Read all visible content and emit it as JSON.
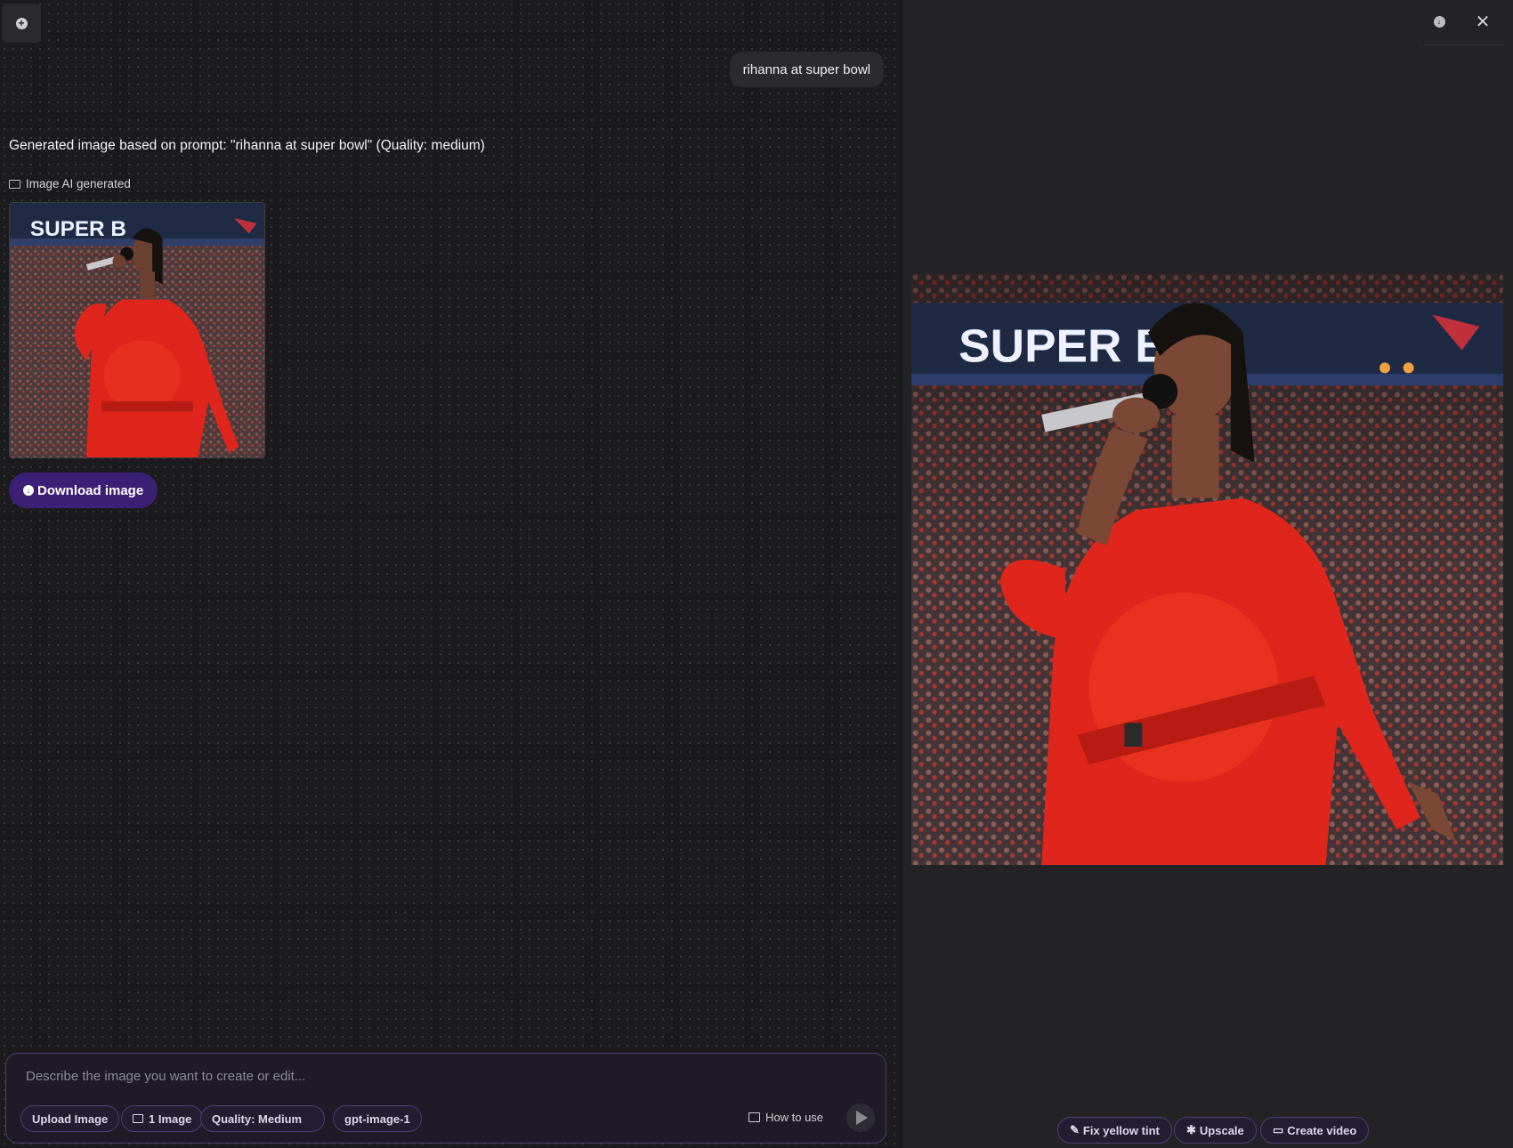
{
  "chat": {
    "user_prompt": "rihanna at super bowl",
    "ai_response": "Generated image based on prompt: \"rihanna at super bowl\" (Quality: medium)",
    "image_label": "Image AI generated",
    "download_label": "Download image"
  },
  "composer": {
    "placeholder": "Describe the image you want to create or edit...",
    "upload_label": "Upload Image",
    "count_label": "1 Image",
    "quality_label": "Quality: Medium",
    "model_label": "gpt-image-1",
    "how_to_use_label": "How to use"
  },
  "image": {
    "banner_text": "SUPER B"
  },
  "preview_actions": {
    "fix_label": "Fix yellow tint",
    "upscale_label": "Upscale",
    "video_label": "Create video"
  },
  "colors": {
    "accent": "#3b1f74",
    "chip_border": "#4d3f78",
    "outfit_red": "#e0261c"
  },
  "icons": [
    "plus-circle-icon",
    "image-icon",
    "download-icon",
    "chat-icon",
    "send-icon",
    "close-icon",
    "pencil-icon",
    "sparkle-icon",
    "video-icon"
  ]
}
